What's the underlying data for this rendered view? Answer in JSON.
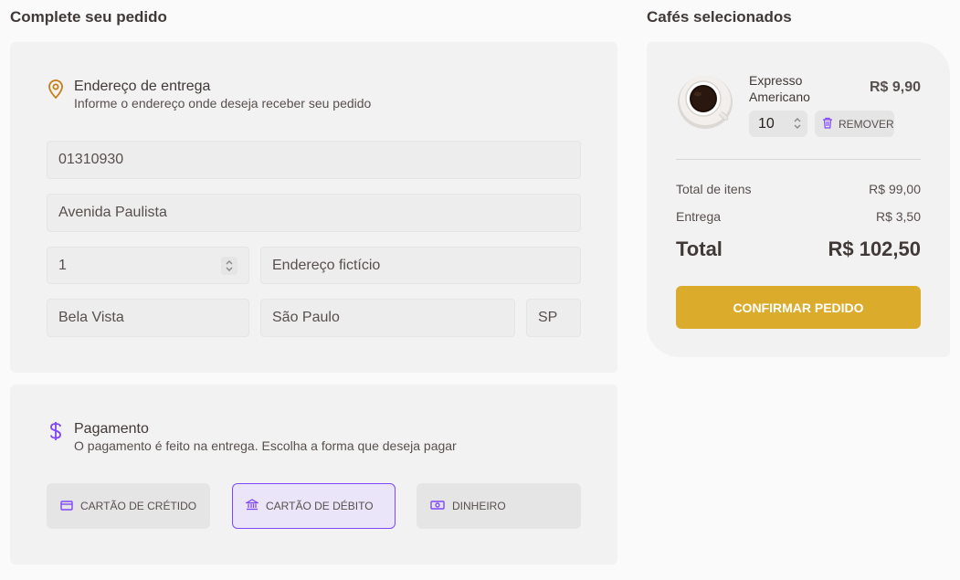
{
  "left_heading": "Complete seu pedido",
  "right_heading": "Cafés selecionados",
  "address": {
    "title": "Endereço de entrega",
    "subtitle": "Informe o endereço onde deseja receber seu pedido",
    "cep": "01310930",
    "street": "Avenida Paulista",
    "number": "1",
    "complement": "Endereço fictício",
    "neighborhood": "Bela Vista",
    "city": "São Paulo",
    "uf": "SP"
  },
  "payment": {
    "title": "Pagamento",
    "subtitle": "O pagamento é feito na entrega. Escolha a forma que deseja pagar",
    "options": [
      {
        "label": "CARTÃO DE CRÉTIDO",
        "icon": "credit-card-icon",
        "selected": false
      },
      {
        "label": "CARTÃO DE DÉBITO",
        "icon": "bank-icon",
        "selected": true
      },
      {
        "label": "DINHEIRO",
        "icon": "money-icon",
        "selected": false
      }
    ]
  },
  "cart": {
    "item": {
      "name_line1": "Expresso",
      "name_line2": "Americano",
      "price": "R$ 9,90",
      "quantity": "10",
      "remove_label": "REMOVER"
    },
    "items_total_label": "Total de itens",
    "items_total_value": "R$ 99,00",
    "delivery_label": "Entrega",
    "delivery_value": "R$ 3,50",
    "total_label": "Total",
    "total_value": "R$ 102,50",
    "confirm_label": "CONFIRMAR PEDIDO"
  },
  "colors": {
    "accent_yellow": "#dbac2c",
    "accent_purple": "#8047f8",
    "dark_yellow": "#c47f17"
  }
}
